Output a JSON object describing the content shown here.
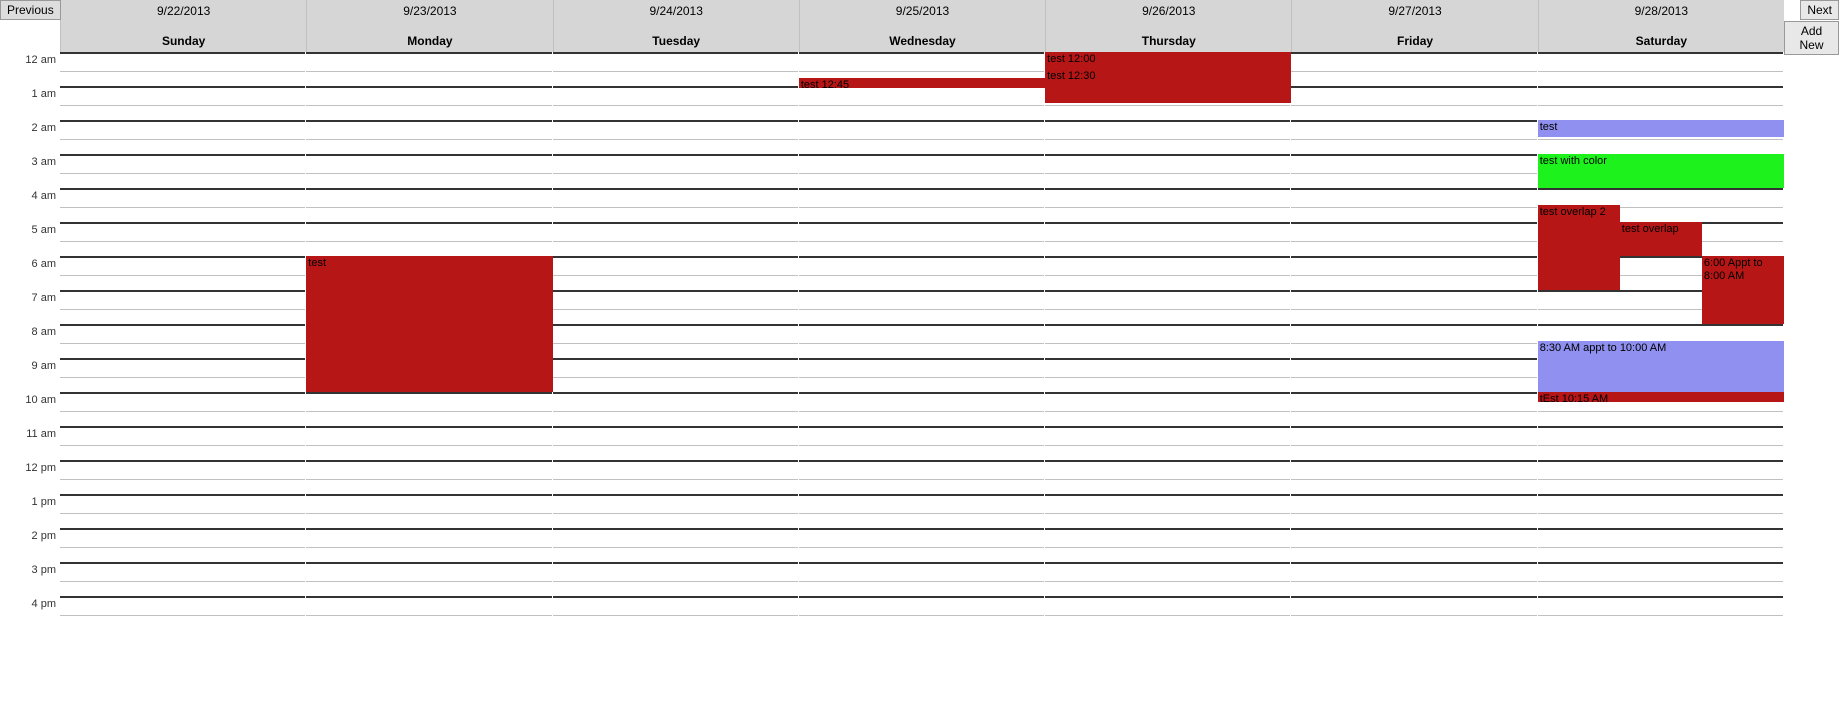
{
  "nav": {
    "prev_label": "Previous",
    "next_label": "Next",
    "addnew_label": "Add New"
  },
  "days": [
    {
      "date": "9/22/2013",
      "dow": "Sunday"
    },
    {
      "date": "9/23/2013",
      "dow": "Monday"
    },
    {
      "date": "9/24/2013",
      "dow": "Tuesday"
    },
    {
      "date": "9/25/2013",
      "dow": "Wednesday"
    },
    {
      "date": "9/26/2013",
      "dow": "Thursday"
    },
    {
      "date": "9/27/2013",
      "dow": "Friday"
    },
    {
      "date": "9/28/2013",
      "dow": "Saturday"
    }
  ],
  "time_labels": [
    "12 am",
    "1 am",
    "2 am",
    "3 am",
    "4 am",
    "5 am",
    "6 am",
    "7 am",
    "8 am",
    "9 am",
    "10 am",
    "11 am",
    "12 pm",
    "1 pm",
    "2 pm",
    "3 pm",
    "4 pm"
  ],
  "colors": {
    "red": "#b61616",
    "blue": "#8f90ef",
    "green": "#1df21d"
  },
  "events": [
    {
      "day": 1,
      "start": 6.0,
      "end": 10.0,
      "label": "test",
      "color": "red",
      "col": 0,
      "cols": 1
    },
    {
      "day": 3,
      "start": 0.75,
      "end": 1.0,
      "label": "test 12:45",
      "color": "red",
      "col": 0,
      "cols": 1
    },
    {
      "day": 4,
      "start": 0.0,
      "end": 0.5,
      "label": "test 12:00",
      "color": "red",
      "col": 0,
      "cols": 1
    },
    {
      "day": 4,
      "start": 0.5,
      "end": 1.5,
      "label": "test 12:30",
      "color": "red",
      "col": 0,
      "cols": 1
    },
    {
      "day": 6,
      "start": 2.0,
      "end": 2.5,
      "label": "test",
      "color": "blue",
      "col": 0,
      "cols": 1
    },
    {
      "day": 6,
      "start": 3.0,
      "end": 4.0,
      "label": "test with color",
      "color": "green",
      "col": 0,
      "cols": 1
    },
    {
      "day": 6,
      "start": 4.5,
      "end": 7.0,
      "label": "test overlap 2",
      "color": "red",
      "col": 0,
      "cols": 3
    },
    {
      "day": 6,
      "start": 5.0,
      "end": 6.0,
      "label": "test overlap",
      "color": "red",
      "col": 1,
      "cols": 3
    },
    {
      "day": 6,
      "start": 6.0,
      "end": 8.0,
      "label": "6:00 Appt to 8:00 AM",
      "color": "red",
      "col": 2,
      "cols": 3
    },
    {
      "day": 6,
      "start": 8.5,
      "end": 10.0,
      "label": "8:30 AM appt to 10:00 AM",
      "color": "blue",
      "col": 0,
      "cols": 1
    },
    {
      "day": 6,
      "start": 10.0,
      "end": 10.25,
      "label": "tEst 10:15 AM",
      "color": "red",
      "col": 0,
      "cols": 1
    }
  ]
}
